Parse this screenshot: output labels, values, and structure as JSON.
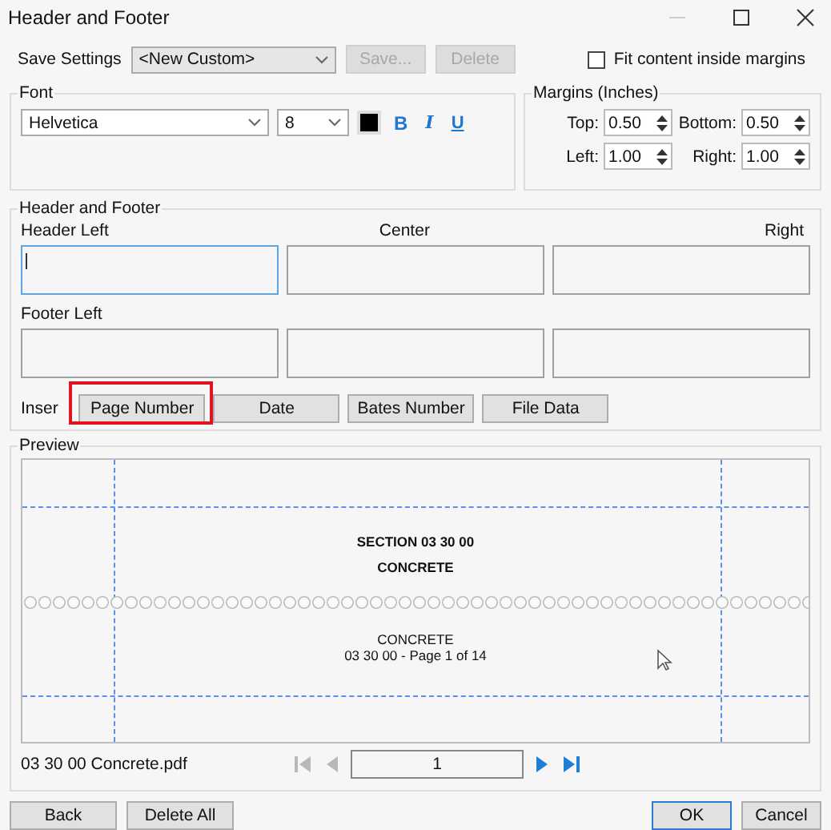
{
  "window": {
    "title": "Header and Footer"
  },
  "save_settings": {
    "label": "Save Settings",
    "value": "<New Custom>",
    "buttons": [
      {
        "label": "Save...",
        "disabled": true
      },
      {
        "label": "Delete",
        "disabled": true
      }
    ]
  },
  "fit_content": {
    "label": "Fit content inside margins",
    "checked": false
  },
  "font": {
    "title": "Font",
    "family": "Helvetica",
    "size": "8",
    "color": "#000000",
    "styles": [
      {
        "kind": "bold",
        "label": "B"
      },
      {
        "kind": "italic",
        "label": "I"
      },
      {
        "kind": "underline",
        "label": "U"
      }
    ]
  },
  "margins": {
    "title": "Margins (Inches)",
    "fields": [
      {
        "label": "Top:",
        "value": "0.50"
      },
      {
        "label": "Bottom:",
        "value": "0.50"
      },
      {
        "label": "Left:",
        "value": "1.00"
      },
      {
        "label": "Right:",
        "value": "1.00"
      }
    ]
  },
  "header_footer": {
    "title": "Header and Footer",
    "header_labels": [
      "Header Left",
      "Center",
      "Right"
    ],
    "header_fields": [
      {
        "focused": true
      },
      {
        "focused": false
      },
      {
        "focused": false
      }
    ],
    "footer_label": "Footer Left",
    "footer_fields": [
      {
        "focused": false
      },
      {
        "focused": false
      },
      {
        "focused": false
      }
    ],
    "insert_label": "Inser",
    "insert_buttons": [
      {
        "label": "Page Number",
        "highlighted": true
      },
      {
        "label": "Date",
        "highlighted": false
      },
      {
        "label": "Bates Number",
        "highlighted": false
      },
      {
        "label": "File Data",
        "highlighted": false
      }
    ]
  },
  "preview": {
    "title": "Preview",
    "page_top": [
      "SECTION 03 30 00",
      "CONCRETE"
    ],
    "footer_lines": [
      "CONCRETE",
      "03 30 00 -  Page 1 of 14"
    ],
    "file_name": "03 30 00 Concrete.pdf",
    "page": "1",
    "nav": [
      {
        "kind": "first",
        "disabled": true
      },
      {
        "kind": "prev",
        "disabled": true
      },
      {
        "kind": "next",
        "disabled": false
      },
      {
        "kind": "last",
        "disabled": false
      }
    ]
  },
  "buttons": [
    {
      "label": "Back",
      "default": false
    },
    {
      "label": "Delete All",
      "default": false
    },
    {
      "label": "OK",
      "default": true
    },
    {
      "label": "Cancel",
      "default": false
    }
  ]
}
